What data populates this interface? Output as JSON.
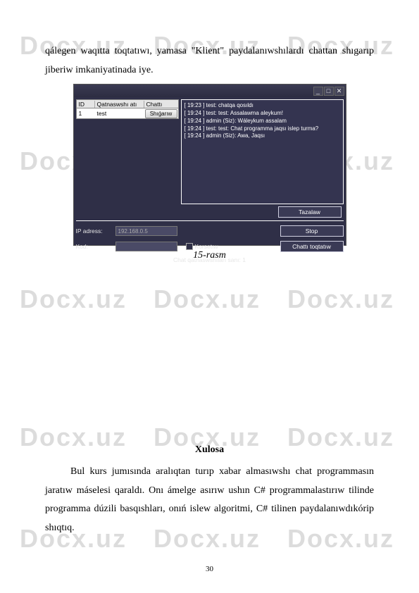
{
  "watermark_text": "Docx.uz",
  "intro_text": "qálegen waqıtta toqtatıwı, yamasa \"Klient\" paydalanıwshılardı chattan shıgarıp jiberiw imkaniyatinada iye.",
  "screenshot": {
    "titlebar": {
      "minimize": "_",
      "maximize": "□",
      "close": "✕"
    },
    "list": {
      "col_id": "ID",
      "col_name": "Qatnaswshı atı",
      "col_action": "Chattı",
      "rows": [
        {
          "id": "1",
          "name": "test",
          "btn": "Shıǵarıw"
        }
      ]
    },
    "chat": [
      "[ 19:23 ] test: chatqa qosıldı",
      "[ 19:24 ] test: test: Assalawma aleykum!",
      "[ 19:24 ] admin (Siz): Wáleykum assalam",
      "[ 19:24 ] test: test: Chat programma jaqsı islep turma?",
      "[ 19:24 ] admin (Siz): Awa, Jaqsı"
    ],
    "btn_clear": "Tazalaw",
    "ip_label": "IP adress:",
    "ip_value": "192.168.0.5",
    "btn_stop": "Stop",
    "kod_label": "Kod:",
    "kod_value": "",
    "chk_label": "Korsetıw",
    "btn_stop_chat": "Chattı toqtatıw",
    "status": "Chat qatnaswshıları sanı: 1"
  },
  "caption": "15-rasm",
  "section_title": "Xulosa",
  "conclusion_text": "Bul kurs jumısında aralıqtan turıp xabar almasıwshı chat programmasın jaratıw máselesi qaraldı. Onı ámelge asırıw ushın  C# programmalastırıw tilinde programma dúzili basqıshları, onıń islew algoritmi, C# tilinen paydalanıwdıkórip shıqtıq.",
  "page_number": "30"
}
